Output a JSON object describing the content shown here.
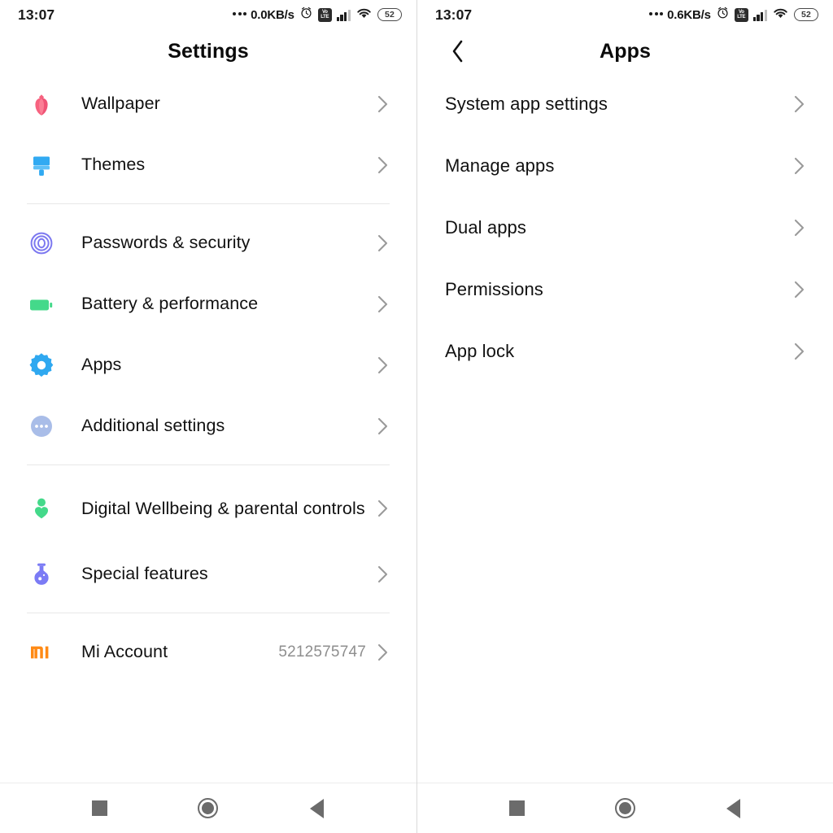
{
  "left": {
    "status_bar": {
      "clock": "13:07",
      "network_speed": "0.0KB/s",
      "volte_top": "Vo",
      "volte_bottom": "LTE",
      "battery_level": "52"
    },
    "header": {
      "title": "Settings"
    },
    "groups": [
      {
        "items": [
          {
            "label": "Wallpaper",
            "icon": "tulip-icon",
            "color": "#F7627F",
            "value": ""
          },
          {
            "label": "Themes",
            "icon": "paintbrush-icon",
            "color": "#31AAF2",
            "value": ""
          }
        ]
      },
      {
        "items": [
          {
            "label": "Passwords & security",
            "icon": "fingerprint-icon",
            "color": "#7C78F0",
            "value": ""
          },
          {
            "label": "Battery & performance",
            "icon": "battery-icon",
            "color": "#44D98A",
            "value": ""
          },
          {
            "label": "Apps",
            "icon": "gear-icon",
            "color": "#2FA8F0",
            "value": ""
          },
          {
            "label": "Additional settings",
            "icon": "more-dots-icon",
            "color": "#A9BDE8",
            "value": ""
          }
        ]
      },
      {
        "items": [
          {
            "label": "Digital Wellbeing & parental controls",
            "icon": "person-heart-icon",
            "color": "#44D98A",
            "value": ""
          },
          {
            "label": "Special features",
            "icon": "flask-icon",
            "color": "#7B7BF5",
            "value": ""
          }
        ]
      },
      {
        "items": [
          {
            "label": "Mi Account",
            "icon": "mi-logo-icon",
            "color": "#FF8A15",
            "value": "5212575747"
          }
        ]
      }
    ],
    "nav": {
      "recents": "recents-button",
      "home": "home-button",
      "back": "back-button"
    }
  },
  "right": {
    "status_bar": {
      "clock": "13:07",
      "network_speed": "0.6KB/s",
      "volte_top": "Vo",
      "volte_bottom": "LTE",
      "battery_level": "52"
    },
    "header": {
      "title": "Apps",
      "back_label": "Back"
    },
    "items": [
      {
        "label": "System app settings"
      },
      {
        "label": "Manage apps"
      },
      {
        "label": "Dual apps"
      },
      {
        "label": "Permissions"
      },
      {
        "label": "App lock"
      }
    ],
    "nav": {
      "recents": "recents-button",
      "home": "home-button",
      "back": "back-button"
    }
  }
}
